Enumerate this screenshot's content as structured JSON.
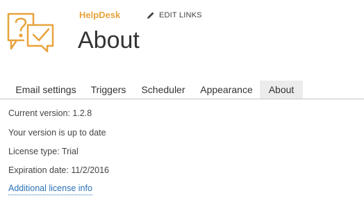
{
  "header": {
    "site_name": "HelpDesk",
    "edit_links_label": "EDIT LINKS",
    "page_title": "About",
    "logo_icon": "helpdesk-question-check-icon",
    "edit_icon": "pencil-icon",
    "accent_color": "#e8a33d"
  },
  "tabs": [
    {
      "label": "Email settings",
      "active": false
    },
    {
      "label": "Triggers",
      "active": false
    },
    {
      "label": "Scheduler",
      "active": false
    },
    {
      "label": "Appearance",
      "active": false
    },
    {
      "label": "About",
      "active": true
    }
  ],
  "info": {
    "current_version": "Current version: 1.2.8",
    "status": "Your version is up to date",
    "license_type": "License type: Trial",
    "expiration": "Expiration date: 11/2/2016"
  },
  "link": {
    "license_info": "Additional license info",
    "color": "#2a72b8"
  }
}
